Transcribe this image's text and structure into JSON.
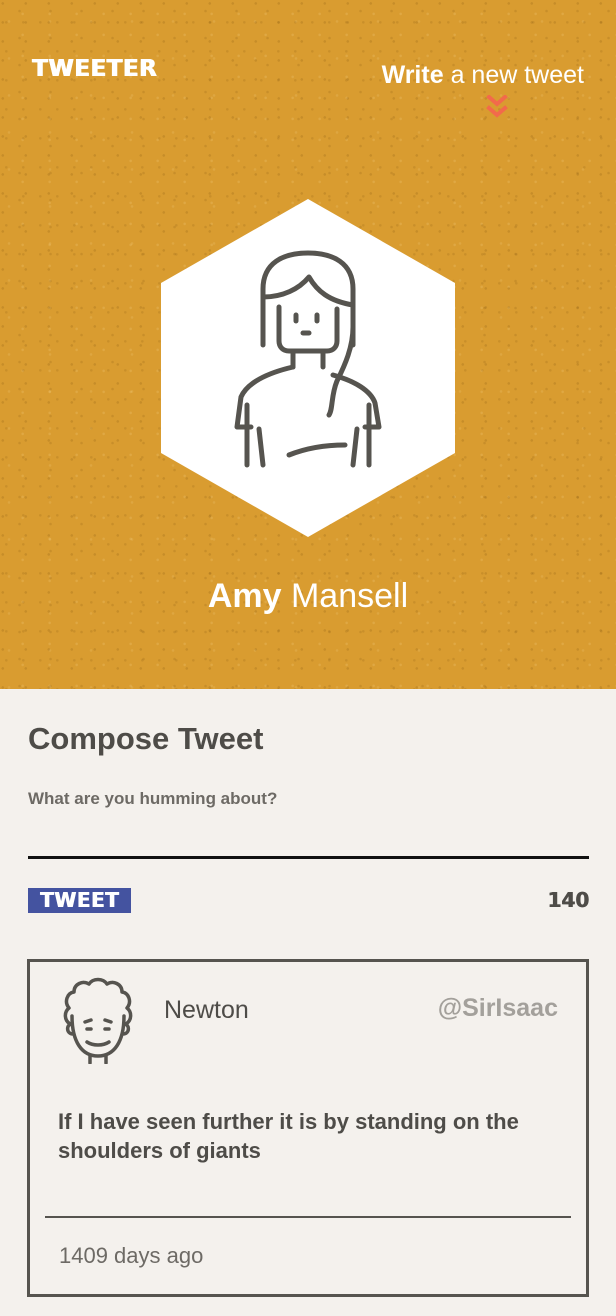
{
  "header": {
    "brand": "TWEETER",
    "write_link": {
      "strong": "Write",
      "rest": "a new tweet",
      "icon": "double-chevron-down-icon"
    }
  },
  "profile": {
    "first_name": "Amy",
    "last_name": "Mansell",
    "avatar_icon": "woman-avatar-icon"
  },
  "compose": {
    "title": "Compose Tweet",
    "label": "What are you humming about?",
    "input_value": "",
    "button_label": "TWEET",
    "char_count": "140"
  },
  "tweets": [
    {
      "author": "Newton",
      "handle": "@SirIsaac",
      "text": "If I have seen further it is by standing on the shoulders of giants",
      "time": "1409 days ago",
      "avatar_icon": "curly-hair-avatar-icon"
    }
  ],
  "colors": {
    "hero_bg": "#d99c30",
    "page_bg": "#f4f1ed",
    "accent_button": "#4453a0",
    "chevron": "#f26a4b",
    "text_dark": "#4e4c48",
    "handle_gray": "#a3a09b"
  }
}
